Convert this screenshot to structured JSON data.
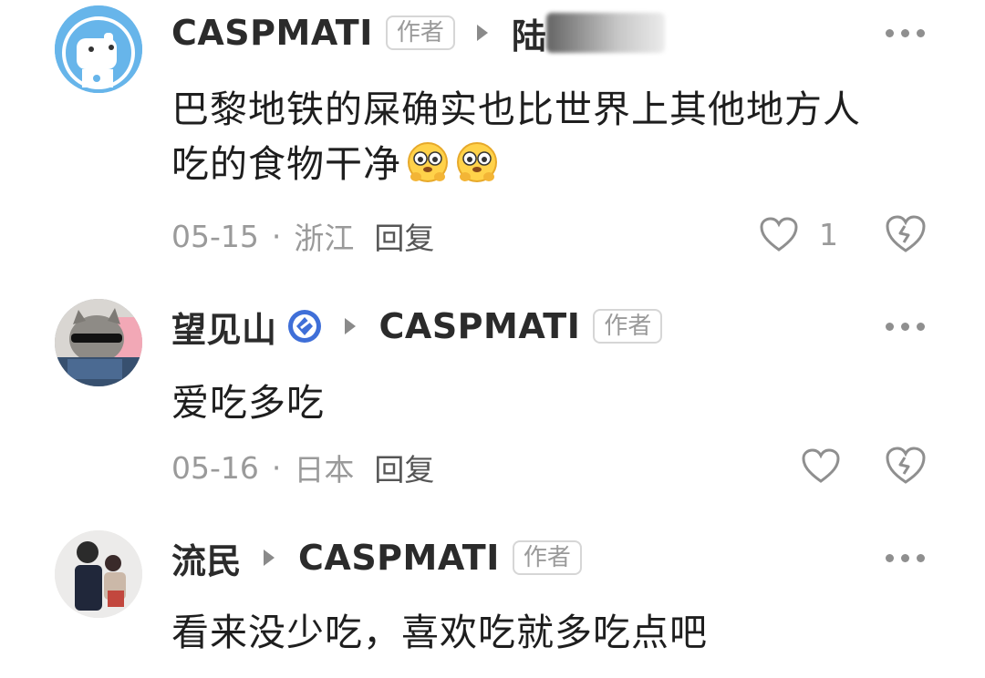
{
  "comments": [
    {
      "user": "CASPMATI",
      "author_tag": "作者",
      "reply_to_partial": "陆",
      "text_line1": "巴黎地铁的屎确实也比世界上其他地方人",
      "text_line2": "吃的食物干净",
      "emojis": [
        "flushed-face-emoji",
        "flushed-face-emoji"
      ],
      "date": "05-15",
      "sep": "·",
      "location": "浙江",
      "reply_label": "回复",
      "likes": "1"
    },
    {
      "user": "望见山",
      "reply_to": "CASPMATI",
      "author_tag": "作者",
      "text": "爱吃多吃",
      "date": "05-16",
      "sep": "·",
      "location": "日本",
      "reply_label": "回复"
    },
    {
      "user": "流民",
      "reply_to": "CASPMATI",
      "author_tag": "作者",
      "text": "看来没少吃，喜欢吃就多吃点吧"
    }
  ],
  "colors": {
    "text": "#1e1e1e",
    "muted": "#9a9a9a",
    "badge_blue": "#3f6fd8",
    "avatar_blue": "#5aaee6"
  }
}
